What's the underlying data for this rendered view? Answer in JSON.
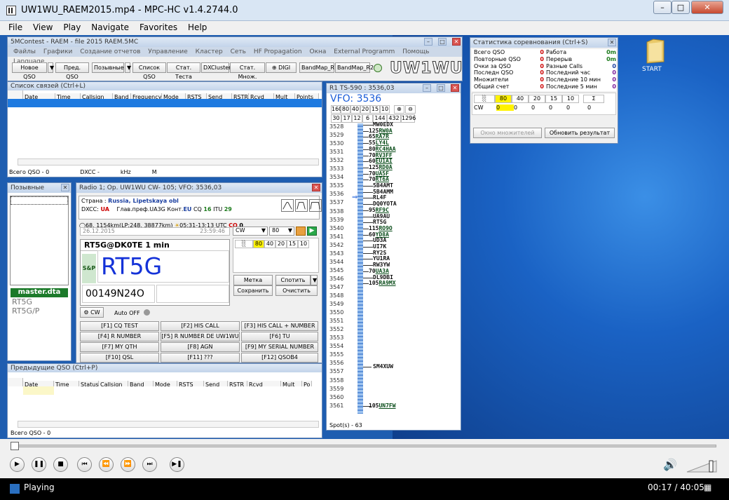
{
  "mpc": {
    "title": "UW1WU_RAEM2015.mp4 - MPC-HC v1.4.2744.0",
    "menu": [
      "File",
      "View",
      "Play",
      "Navigate",
      "Favorites",
      "Help"
    ],
    "status": "Playing",
    "time": "00:17 / 40:05"
  },
  "desktop": {
    "icon_label": "START"
  },
  "contest": {
    "title": "5MContest - RAEM - file 2015 RAEM.5MC",
    "menu": [
      "Файлы",
      "Графики",
      "Создание отчетов",
      "Управление",
      "Кластер",
      "Сеть",
      "HF Propagation",
      "Окна",
      "External Programm",
      "Помощь",
      "Language"
    ],
    "toolbar": [
      "Новое QSO",
      "Пред. QSO",
      "Позывные",
      "Список QSO",
      "Стат. Теста",
      "DXCluster",
      "Стат. Множ.",
      "DIGI",
      "BandMap_R1",
      "BandMap_R2"
    ],
    "callsign": "UW1WU"
  },
  "log": {
    "title": "Список связей (Ctrl+L)",
    "columns": [
      "Date",
      "Time",
      "Callsign",
      "Band",
      "Frequency",
      "Mode",
      "RSTS",
      "Send",
      "RSTR",
      "Rcvd",
      "Mult",
      "Points"
    ],
    "footer": [
      "Всего QSO - 0",
      "DXCC -",
      "kHz",
      "M"
    ]
  },
  "calls": {
    "title": "Позывные",
    "master": "master.dta",
    "items": [
      "RT5G",
      "RT5G/P"
    ]
  },
  "radio": {
    "title": "Radio 1; Op. UW1WU CW- 105; VFO: 3536,03",
    "country_label": "Страна :",
    "country": "Russia, Lipetskaya obl",
    "dxcc_label": "DXCC:",
    "dxcc": "UA",
    "pref": "Глав.преф.UA3G",
    "cont_label": "Конт.",
    "cont": "EU",
    "cq_label": "CQ",
    "cq": "16",
    "itu_label": "ITU",
    "itu": "29",
    "dist": "68, 1154km(LP:248, 38877km)",
    "sun": "05:31-13:13 UTC",
    "cq2_label": "CQ",
    "cq2": "0",
    "date": "26.12.2015",
    "time": "23:59:46",
    "mode": "CW",
    "power": "80",
    "bands": [
      "80",
      "40",
      "20",
      "15",
      "10"
    ],
    "spotinfo": "RT5G@DK0TE 1 min",
    "sp": "S&P",
    "call": "RT5G",
    "exchange": "00149N24O",
    "btn_mark": "Метка",
    "btn_spot": "Спотить",
    "btn_save": "Сохранить",
    "btn_clear": "Очистить",
    "cw": "CW",
    "auto": "Auto OFF",
    "fkeys": [
      "[F1] CQ TEST",
      "[F2] HIS CALL",
      "[F3] HIS CALL + NUMBER",
      "[F4] R NUMBER",
      "[F5] R NUMBER DE UW1WU",
      "[F6] TU",
      "[F7] MY QTH",
      "[F8] AGN",
      "[F9] MY SERIAL NUMBER",
      "[F10] QSL",
      "[F11] ???",
      "[F12] QSOB4"
    ]
  },
  "prev": {
    "title": "Предыдущие QSO (Ctrl+P)",
    "columns": [
      "Date",
      "Time",
      "Status",
      "Callsign",
      "Band",
      "Mode",
      "RSTS",
      "Send",
      "RSTR",
      "Rcvd",
      "Mult",
      "Po"
    ],
    "footer": "Всего QSO - 0"
  },
  "bandmap": {
    "title": "R1 TS-590 : 3536,03",
    "vfo": "VFO: 3536",
    "btns1": [
      "160",
      "80",
      "40",
      "20",
      "15",
      "10"
    ],
    "btns2": [
      "30",
      "17",
      "12",
      "6",
      "144",
      "432",
      "1296"
    ],
    "footer": "Spot(s) - 63",
    "freqs": [
      "3528",
      "3529",
      "3530",
      "3531",
      "3532",
      "3533",
      "3534",
      "3535",
      "3536",
      "3537",
      "3538",
      "3539",
      "3540",
      "3541",
      "3542",
      "3543",
      "3544",
      "3545",
      "3546",
      "3547",
      "3548",
      "3549",
      "3550",
      "3551",
      "3552",
      "3553",
      "3554",
      "3555",
      "3556",
      "3557",
      "3558",
      "3559",
      "3560",
      "3561"
    ],
    "spots": [
      {
        "n": "",
        "c": "MW0EDX"
      },
      {
        "n": "125",
        "c": "RW0A"
      },
      {
        "n": "65",
        "c": "RA7R"
      },
      {
        "n": "55",
        "c": "LY4L"
      },
      {
        "n": "80",
        "c": "RC4HAA"
      },
      {
        "n": "70",
        "c": "RV3FF"
      },
      {
        "n": "60",
        "c": "EU1AI"
      },
      {
        "n": "125",
        "c": "RD0A"
      },
      {
        "n": "70",
        "c": "UA5F"
      },
      {
        "n": "70",
        "c": "RT6A"
      },
      {
        "n": "",
        "c": "5B4AMT"
      },
      {
        "n": "",
        "c": "5B4AMM"
      },
      {
        "n": "",
        "c": "RL4F"
      },
      {
        "n": "",
        "c": "DQ0YOTA"
      },
      {
        "n": "95",
        "c": "RF9C"
      },
      {
        "n": "",
        "c": "UA9AU"
      },
      {
        "n": "",
        "c": "RT5G"
      },
      {
        "n": "115",
        "c": "RO9O"
      },
      {
        "n": "60",
        "c": "YD8A"
      },
      {
        "n": "",
        "c": "UD3A"
      },
      {
        "n": "",
        "c": "UI7K"
      },
      {
        "n": "",
        "c": "RY2S"
      },
      {
        "n": "",
        "c": "YU1RA"
      },
      {
        "n": "",
        "c": "RW3YW"
      },
      {
        "n": "70",
        "c": "UA3A"
      },
      {
        "n": "",
        "c": "DL9DBI"
      },
      {
        "n": "105",
        "c": "RA9MX"
      }
    ],
    "low_spots": [
      {
        "n": "",
        "c": "SM4XUW"
      },
      {
        "n": "105",
        "c": "UN7FW"
      }
    ]
  },
  "stats": {
    "title": "Статистика соревнования (Ctrl+S)",
    "left": [
      [
        "Всего QSO",
        "0"
      ],
      [
        "Повторные QSO",
        "0"
      ],
      [
        "Очки за QSO",
        "0"
      ],
      [
        "Последн QSO",
        "0"
      ],
      [
        "Множители",
        "0"
      ],
      [
        "Общий счет",
        "0"
      ]
    ],
    "right": [
      [
        "Работа",
        "0m"
      ],
      [
        "Перерыв",
        "0m"
      ],
      [
        "Разные Calls",
        "0"
      ],
      [
        "Последний час",
        "0"
      ],
      [
        "Последние 10 мин",
        "0"
      ],
      [
        "Последние  5 мин",
        "0"
      ]
    ],
    "bands": [
      "80",
      "40",
      "20",
      "15",
      "10"
    ],
    "sigma": "Σ",
    "row_label": "CW",
    "row": [
      "0",
      "0",
      "0",
      "0",
      "0",
      "0"
    ],
    "btn1": "Окно множителей",
    "btn2": "Обновить результат"
  }
}
